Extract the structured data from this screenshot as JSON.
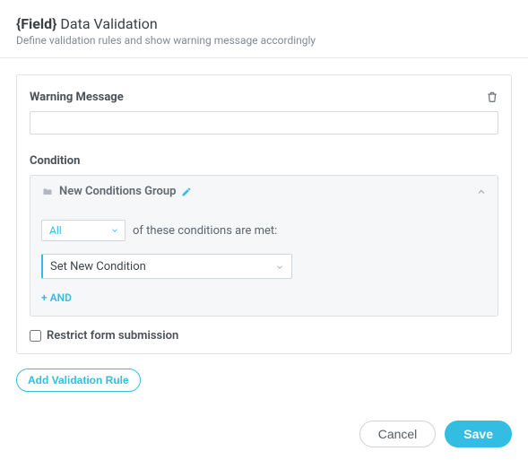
{
  "header": {
    "title_prefix": "{Field}",
    "title_rest": " Data Validation",
    "subtitle": "Define validation rules and show warning message accordingly"
  },
  "warning": {
    "label": "Warning Message",
    "value": "",
    "placeholder": ""
  },
  "condition": {
    "label": "Condition",
    "group_title": "New Conditions Group",
    "quantifier_selected": "All",
    "quantifier_suffix": "of these conditions are met:",
    "new_condition_placeholder": "Set New Condition",
    "add_and_label": "+ AND"
  },
  "restrict": {
    "label": "Restrict form submission",
    "checked": false
  },
  "actions": {
    "add_rule": "Add Validation Rule",
    "cancel": "Cancel",
    "save": "Save"
  },
  "icons": {
    "trash": "trash-icon",
    "folder": "folder-icon",
    "pencil": "pencil-icon",
    "chevron_up": "chevron-up-icon",
    "chevron_down": "chevron-down-icon"
  }
}
